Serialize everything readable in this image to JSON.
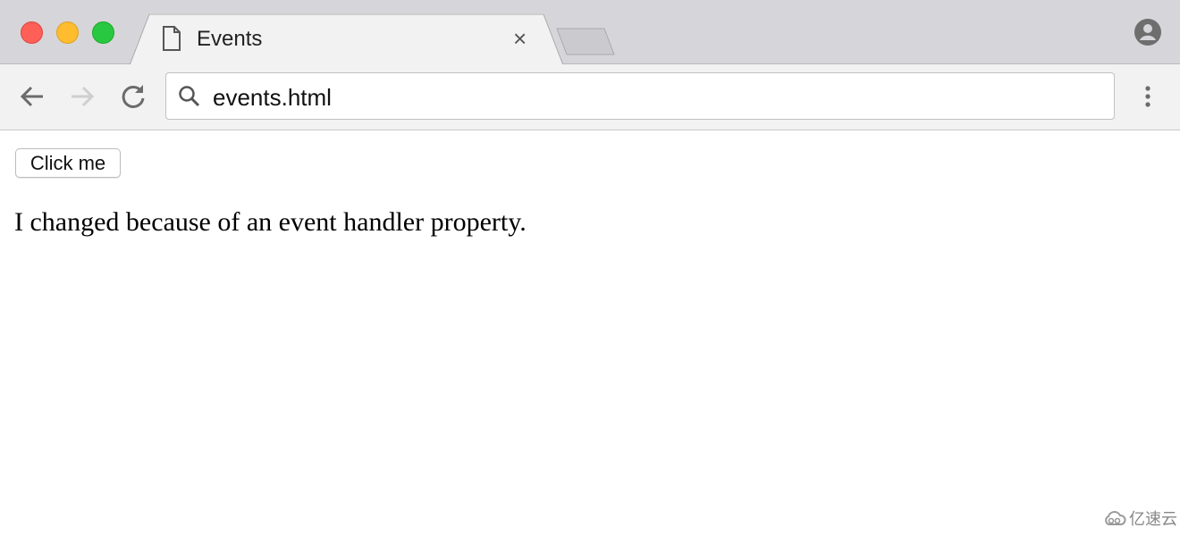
{
  "window": {
    "traffic_lights": {
      "close": "#fe5f57",
      "minimize": "#febc2e",
      "maximize": "#28c840"
    }
  },
  "tab": {
    "title": "Events",
    "icon": "page-icon",
    "close_label": "×"
  },
  "toolbar": {
    "url": "events.html"
  },
  "page": {
    "button_label": "Click me",
    "paragraph": "I changed because of an event handler property."
  },
  "watermark": {
    "text": "亿速云"
  }
}
